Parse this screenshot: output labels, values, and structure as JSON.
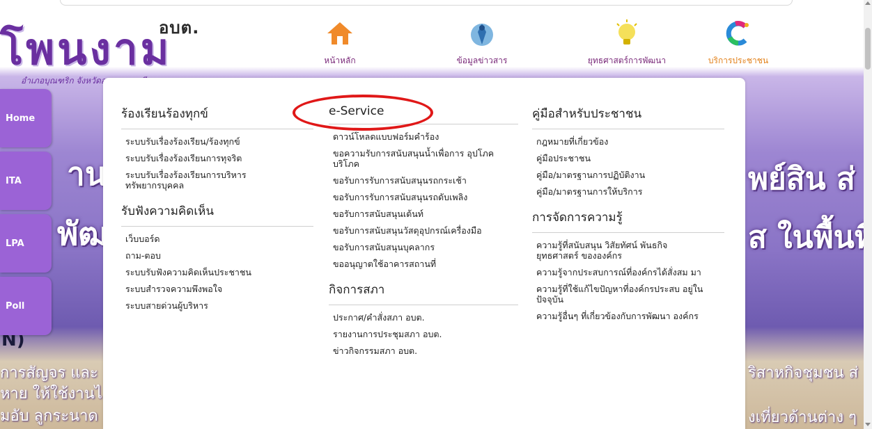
{
  "logo": {
    "abbr": "อบต.",
    "name": "โพนงาม",
    "subtitle": "อำเภอบุณฑริก  จังหวัดอุบลราชธานี"
  },
  "nav": [
    {
      "label": "หน้าหลัก",
      "icon": "home-icon"
    },
    {
      "label": "ข้อมูลข่าวสาร",
      "icon": "info-emblem-icon"
    },
    {
      "label": "ยุทธศาสตร์การพัฒนา",
      "icon": "lightbulb-icon"
    },
    {
      "label": "บริการประชาชน",
      "icon": "service-c-icon",
      "active": true
    }
  ],
  "side_tabs": [
    "Home",
    "ITA",
    "LPA",
    "Poll"
  ],
  "hero": {
    "line1_left": "านด้",
    "line2_left": "พัฒ",
    "right1": "พย์สิน ส่",
    "right2": "ส ในพื้นที",
    "n_left": "N)",
    "b1": "การสัญจร และ",
    "b2": "หาย ให้ใช้งานไ",
    "b3": "มอับ ลูกระนาด",
    "br1": "ริสาหกิจชุมชน ส่",
    "br2": "งเที่ยวด้านต่าง ๆ"
  },
  "menu": {
    "col1": {
      "heading": "ร้องเรียนร้องทุกข์",
      "items": [
        "ระบบรับเรื่องร้องเรียน/ร้องทุกข์",
        "ระบบรับเรื่องร้องเรียนการทุจริต",
        "ระบบรับเรื่องร้องเรียนการบริหาร ทรัพยากรบุคคล"
      ],
      "heading2": "รับฟังความคิดเห็น",
      "items2": [
        "เว็บบอร์ด",
        "ถาม-ตอบ",
        "ระบบรับฟังความคิดเห็นประชาชน",
        "ระบบสำรวจความพึงพอใจ",
        "ระบบสายด่วนผู้บริหาร"
      ]
    },
    "col2": {
      "heading": "e-Service",
      "items": [
        "ดาวน์โหลดแบบฟอร์มคำร้อง",
        "ขอความรับการสนับสนุนน้ำเพื่อการ อุปโภคบริโภค",
        "ขอรับการรับการสนับสนุนรถกระเช้า",
        "ขอรับการรับการสนับสนุนรถดับเพลิง",
        "ขอรับการสนับสนุนเต้นท์",
        "ขอรับการสนับสนุนวัสดุอุปกรณ์เครื่องมือ",
        "ขอรับการสนับสนุนบุคลากร",
        "ขออนุญาตใช้อาคารสถานที่"
      ],
      "heading2": "กิจการสภา",
      "items2": [
        "ประกาศ/คำสั่งสภา อบต.",
        "รายงานการประชุมสภา อบต.",
        "ข่าวกิจกรรมสภา อบต."
      ]
    },
    "col3": {
      "heading": "คู่มือสำหรับประชาชน",
      "items": [
        "กฎหมายที่เกี่ยวข้อง",
        "คู่มือประชาชน",
        "คู่มือ/มาตรฐานการปฏิบัติงาน",
        "คู่มือ/มาตรฐานการให้บริการ"
      ],
      "heading2": "การจัดการความรู้",
      "items2": [
        "ความรู้ที่สนับสนุน วิสัยทัศน์ พันธกิจ ยุทธศาสตร์ ขององค์กร",
        "ความรู้จากประสบการณ์ที่องค์กรได้สั่งสม มา",
        "ความรู้ที่ใช้แก้ไขปัญหาที่องค์กรประสบ อยู่ในปัจจุบัน",
        "ความรู้อื่นๆ ที่เกี่ยวข้องกับการพัฒนา องค์กร"
      ]
    }
  },
  "colors": {
    "brand_purple": "#6a2fa0",
    "side_tab": "#9b63d6",
    "highlight_red": "#e01818",
    "nav_active": "#e2811a"
  }
}
